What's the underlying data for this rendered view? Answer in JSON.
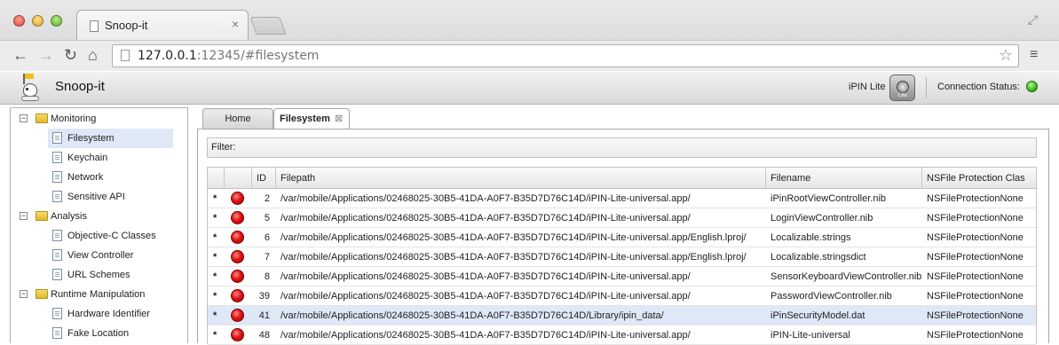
{
  "browser": {
    "tab_title": "Snoop-it",
    "url_host": "127.0.0.1",
    "url_port": ":12345",
    "url_path": "/#filesystem"
  },
  "app": {
    "title": "Snoop-it",
    "device_app": "iPIN Lite",
    "device_icon_label": "Lite",
    "connection_label": "Connection Status:",
    "connection_color": "#3fbf1f"
  },
  "sidebar": {
    "groups": [
      {
        "label": "Monitoring",
        "items": [
          "Filesystem",
          "Keychain",
          "Network",
          "Sensitive API"
        ]
      },
      {
        "label": "Analysis",
        "items": [
          "Objective-C Classes",
          "View Controller",
          "URL Schemes"
        ]
      },
      {
        "label": "Runtime Manipulation",
        "items": [
          "Hardware Identifier",
          "Fake Location"
        ]
      }
    ],
    "toggle_symbol": "−",
    "selected": "Filesystem"
  },
  "tabs": {
    "home": "Home",
    "filesystem": "Filesystem",
    "close_symbol": "⊠"
  },
  "filter": {
    "label": "Filter:"
  },
  "table": {
    "columns": [
      "ID",
      "Filepath",
      "Filename",
      "NSFile Protection Clas"
    ],
    "rows": [
      {
        "star": "*",
        "id": "2",
        "path": "/var/mobile/Applications/02468025-30B5-41DA-A0F7-B35D7D76C14D/iPIN-Lite-universal.app/",
        "name": "iPinRootViewController.nib",
        "prot": "NSFileProtectionNone"
      },
      {
        "star": "*",
        "id": "5",
        "path": "/var/mobile/Applications/02468025-30B5-41DA-A0F7-B35D7D76C14D/iPIN-Lite-universal.app/",
        "name": "LoginViewController.nib",
        "prot": "NSFileProtectionNone"
      },
      {
        "star": "*",
        "id": "6",
        "path": "/var/mobile/Applications/02468025-30B5-41DA-A0F7-B35D7D76C14D/iPIN-Lite-universal.app/English.lproj/",
        "name": "Localizable.strings",
        "prot": "NSFileProtectionNone"
      },
      {
        "star": "*",
        "id": "7",
        "path": "/var/mobile/Applications/02468025-30B5-41DA-A0F7-B35D7D76C14D/iPIN-Lite-universal.app/English.lproj/",
        "name": "Localizable.stringsdict",
        "prot": "NSFileProtectionNone"
      },
      {
        "star": "*",
        "id": "8",
        "path": "/var/mobile/Applications/02468025-30B5-41DA-A0F7-B35D7D76C14D/iPIN-Lite-universal.app/",
        "name": "SensorKeyboardViewController.nib",
        "prot": "NSFileProtectionNone"
      },
      {
        "star": "*",
        "id": "39",
        "path": "/var/mobile/Applications/02468025-30B5-41DA-A0F7-B35D7D76C14D/iPIN-Lite-universal.app/",
        "name": "PasswordViewController.nib",
        "prot": "NSFileProtectionNone"
      },
      {
        "star": "*",
        "id": "41",
        "path": "/var/mobile/Applications/02468025-30B5-41DA-A0F7-B35D7D76C14D/Library/ipin_data/",
        "name": "iPinSecurityModel.dat",
        "prot": "NSFileProtectionNone",
        "selected": true
      },
      {
        "star": "*",
        "id": "48",
        "path": "/var/mobile/Applications/02468025-30B5-41DA-A0F7-B35D7D76C14D/iPIN-Lite-universal.app/",
        "name": "iPIN-Lite-universal",
        "prot": "NSFileProtectionNone"
      }
    ],
    "status_color": "#e01515"
  }
}
